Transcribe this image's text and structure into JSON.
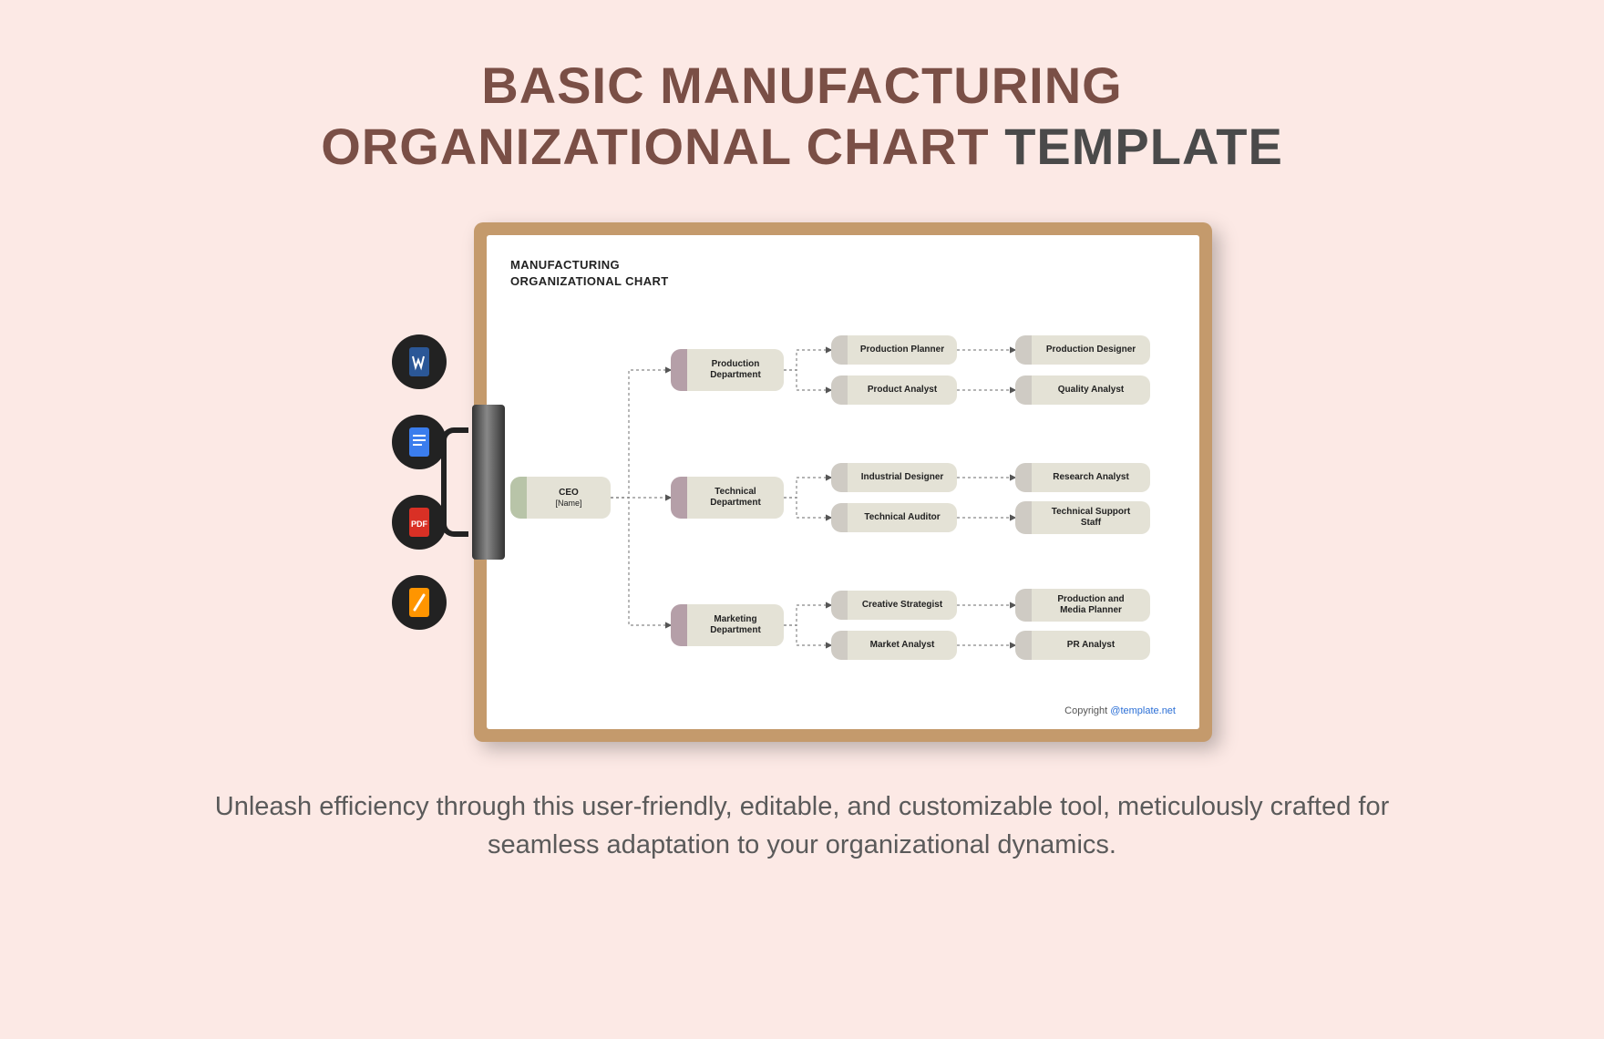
{
  "title": {
    "line1": "BASIC MANUFACTURING",
    "line2_brown": "ORGANIZATIONAL CHART",
    "line2_dark": "TEMPLATE"
  },
  "formats": [
    "word",
    "gdocs",
    "pdf",
    "pages"
  ],
  "chart": {
    "heading_line1": "MANUFACTURING",
    "heading_line2": "ORGANIZATIONAL CHART",
    "ceo": {
      "title": "CEO",
      "sub": "[Name]"
    },
    "departments": [
      {
        "name": "Production\nDepartment",
        "roles_a": [
          "Production Planner",
          "Product Analyst"
        ],
        "roles_b": [
          "Production Designer",
          "Quality Analyst"
        ]
      },
      {
        "name": "Technical\nDepartment",
        "roles_a": [
          "Industrial Designer",
          "Technical Auditor"
        ],
        "roles_b": [
          "Research Analyst",
          "Technical Support\nStaff"
        ]
      },
      {
        "name": "Marketing\nDepartment",
        "roles_a": [
          "Creative Strategist",
          "Market Analyst"
        ],
        "roles_b": [
          "Production and\nMedia Planner",
          "PR Analyst"
        ]
      }
    ],
    "copyright_label": "Copyright ",
    "copyright_link": "@template.net"
  },
  "description": "Unleash efficiency through this user-friendly, editable, and customizable tool, meticulously crafted for seamless adaptation to your organizational dynamics."
}
